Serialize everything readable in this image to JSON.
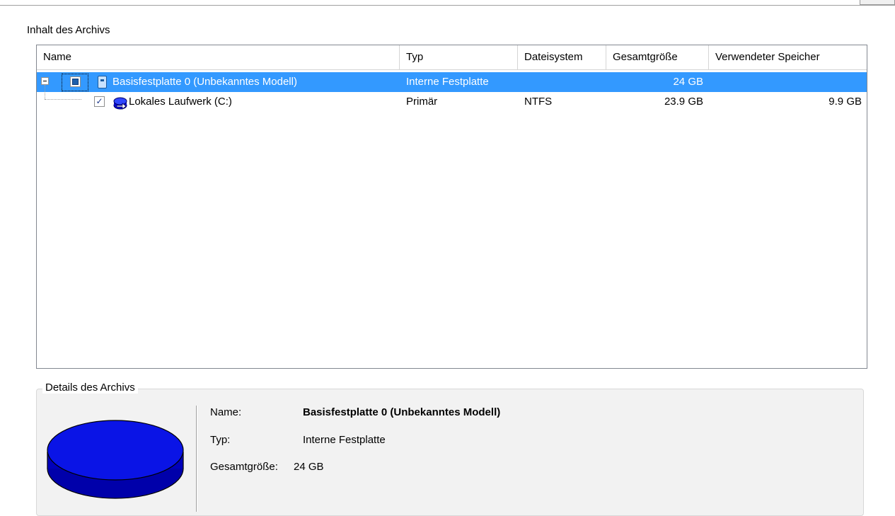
{
  "content_section": {
    "title": "Inhalt des Archivs",
    "columns": [
      "Name",
      "Typ",
      "Dateisystem",
      "Gesamtgröße",
      "Verwendeter Speicher"
    ],
    "rows": [
      {
        "name": "Basisfestplatte 0 (Unbekanntes Modell)",
        "type": "Interne Festplatte",
        "filesystem": "",
        "total_size": "24 GB",
        "used": "",
        "selected": true
      },
      {
        "name": "Lokales Laufwerk (C:)",
        "type": "Primär",
        "filesystem": "NTFS",
        "total_size": "23.9 GB",
        "used": "9.9 GB",
        "selected": false
      }
    ]
  },
  "details_section": {
    "title": "Details des Archivs",
    "name_label": "Name:",
    "name_value": "Basisfestplatte 0 (Unbekanntes Modell)",
    "type_label": "Typ:",
    "type_value": "Interne Festplatte",
    "size_label": "Gesamtgröße:",
    "size_value": "24 GB"
  },
  "colors": {
    "selection": "#3399ff",
    "disk_blue": "#0000cc"
  },
  "icons": {
    "expander": "collapse-minus-icon",
    "disk": "hard-disk-icon",
    "partition": "partition-icon",
    "large_disk": "disk-platter-icon"
  }
}
